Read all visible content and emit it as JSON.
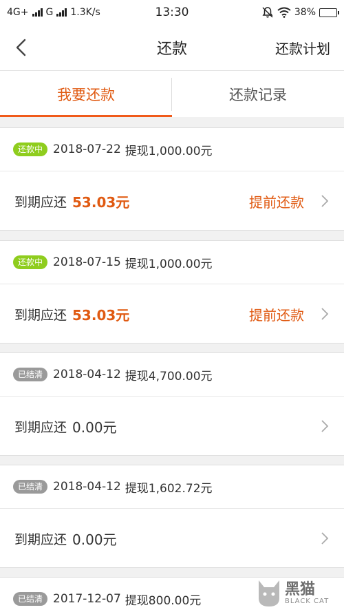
{
  "status_bar": {
    "network1": "4G+",
    "network2": "G",
    "speed": "1.3K/s",
    "time": "13:30",
    "battery": "38%",
    "battery_level": 0.38
  },
  "nav": {
    "title": "还款",
    "plan": "还款计划"
  },
  "tabs": [
    {
      "label": "我要还款",
      "active": true
    },
    {
      "label": "还款记录",
      "active": false
    }
  ],
  "loans": [
    {
      "badge": "还款中",
      "date": "2018-07-22",
      "desc": "提现1,000.00元",
      "due_label": "到期应还",
      "due": "53.03元",
      "action": "提前还款"
    },
    {
      "badge": "还款中",
      "date": "2018-07-15",
      "desc": "提现1,000.00元",
      "due_label": "到期应还",
      "due": "53.03元",
      "action": "提前还款"
    },
    {
      "badge": "已结清",
      "date": "2018-04-12",
      "desc": "提现4,700.00元",
      "due_label": "到期应还",
      "due": "0.00元"
    },
    {
      "badge": "已结清",
      "date": "2018-04-12",
      "desc": "提现1,602.72元",
      "due_label": "到期应还",
      "due": "0.00元"
    },
    {
      "badge": "已结清",
      "date": "2017-12-07",
      "desc": "提现800.00元"
    }
  ],
  "watermark": {
    "brand_cn": "黑猫",
    "brand_en": "BLACK CAT"
  },
  "colors": {
    "accent": "#e05a12",
    "badge_active": "#8fcd1e",
    "badge_done": "#9a9a9a"
  }
}
